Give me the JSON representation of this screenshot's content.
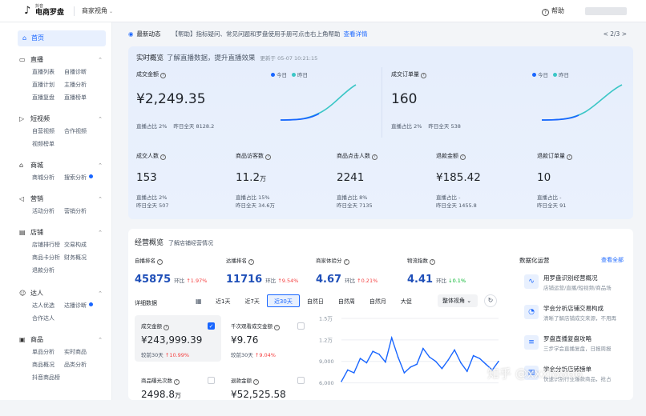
{
  "topbar": {
    "logo_small": "抖音",
    "logo_text": "电商罗盘",
    "view_switch": "商家视角",
    "help": "帮助"
  },
  "sidebar": {
    "home": "首页",
    "groups": [
      {
        "title": "直播",
        "items": [
          "直播列表",
          "自播诊断",
          "直播计划",
          "主播分析",
          "直播复盘",
          "直播榜单"
        ]
      },
      {
        "title": "短视频",
        "items": [
          "自营视频",
          "合作视频",
          "视频榜单"
        ]
      },
      {
        "title": "商城",
        "items": [
          "商城分析",
          "搜索分析"
        ]
      },
      {
        "title": "营销",
        "items": [
          "活动分析",
          "营销分析"
        ]
      },
      {
        "title": "店铺",
        "items": [
          "店铺排行榜",
          "交易构成",
          "商品卡分析",
          "财务概况",
          "退款分析"
        ]
      },
      {
        "title": "达人",
        "items": [
          "达人优选",
          "达播诊断",
          "合作达人"
        ]
      },
      {
        "title": "商品",
        "items": [
          "单品分析",
          "实时商品",
          "商品概况",
          "品类分析",
          "抖音商品榜"
        ]
      }
    ]
  },
  "notice": {
    "label": "最新动态",
    "message": "【帮助】指标疑问、常见问题和罗盘使用手册可点击右上角帮助",
    "link": "查看详情",
    "pager": "< 2/3 >"
  },
  "realtime": {
    "title": "实时概览",
    "subtitle": "了解直播数据，提升直播效果",
    "updated": "更新于 05-07 10:21:15",
    "legend_today": "今日",
    "legend_yesterday": "昨日",
    "gmv": {
      "label": "成交金额",
      "value": "¥2,249.35",
      "share": "直播占比 2%",
      "yesterday": "昨日全天 8128.2"
    },
    "orders": {
      "label": "成交订单量",
      "value": "160",
      "share": "直播占比 2%",
      "yesterday": "昨日全天 538"
    },
    "small": [
      {
        "label": "成交人数",
        "value": "153",
        "unit": "",
        "share": "直播占比 2%",
        "yesterday": "昨日全天 507"
      },
      {
        "label": "商品访客数",
        "value": "11.2",
        "unit": "万",
        "share": "直播占比 15%",
        "yesterday": "昨日全天 34.6万"
      },
      {
        "label": "商品点击人数",
        "value": "2241",
        "unit": "",
        "share": "直播占比 8%",
        "yesterday": "昨日全天 7135"
      },
      {
        "label": "退款金额",
        "value": "¥185.42",
        "unit": "",
        "share": "直播占比 -",
        "yesterday": "昨日全天 1455.8"
      },
      {
        "label": "退款订单量",
        "value": "10",
        "unit": "",
        "share": "直播占比 -",
        "yesterday": "昨日全天 91"
      }
    ]
  },
  "business": {
    "title": "经营概览",
    "subtitle": "了解店铺经营情况",
    "kpis": [
      {
        "label": "自播排名",
        "value": "45875",
        "rate_label": "环比",
        "rate": "1.97%",
        "dir": "up"
      },
      {
        "label": "达播排名",
        "value": "11716",
        "rate_label": "环比",
        "rate": "9.54%",
        "dir": "up"
      },
      {
        "label": "商家体验分",
        "value": "4.67",
        "rate_label": "环比",
        "rate": "0.21%",
        "dir": "up"
      },
      {
        "label": "物流指数",
        "value": "4.41",
        "rate_label": "环比",
        "rate": "0.1%",
        "dir": "down"
      }
    ],
    "detail_label": "详细数据",
    "ranges": [
      "近1天",
      "近7天",
      "近30天",
      "自然日",
      "自然周",
      "自然月",
      "大促"
    ],
    "active_range": 2,
    "view_select": "整体视角",
    "cards": [
      {
        "label": "成交金额",
        "value": "¥243,999.39",
        "unit": "",
        "foot_label": "较前30天",
        "rate": "10.99%",
        "checked": true
      },
      {
        "label": "千次观看成交金额",
        "value": "¥9.76",
        "unit": "",
        "foot_label": "较前30天",
        "rate": "9.04%",
        "checked": false
      },
      {
        "label": "商品曝光次数",
        "value": "2498.8",
        "unit": "万",
        "foot_label": "",
        "rate": "",
        "checked": false
      },
      {
        "label": "退款金额",
        "value": "¥52,525.58",
        "unit": "",
        "foot_label": "",
        "rate": "",
        "checked": false
      }
    ],
    "trend": {
      "type": "line",
      "y_ticks": [
        "1.5万",
        "1.2万",
        "9,000",
        "6,000"
      ],
      "values": [
        6200,
        7800,
        7400,
        9400,
        8800,
        10400,
        10000,
        8900,
        12300,
        9600,
        7400,
        8200,
        8600,
        10800,
        9600,
        9000,
        8000,
        9200,
        10600,
        8800,
        7600,
        9800,
        9400,
        8600,
        7800,
        9000
      ]
    },
    "side": {
      "title": "数据化运营",
      "all": "查看全部",
      "items": [
        {
          "icon": "chart-icon",
          "title": "用罗盘识别经营概况",
          "desc": "店铺运营/直播/短视频/商品场"
        },
        {
          "icon": "pie-icon",
          "title": "学会分析店铺交易构成",
          "desc": "清晰了解店铺成交来源，不用再"
        },
        {
          "icon": "doc-icon",
          "title": "罗盘直播复盘攻略",
          "desc": "三步学会直播复盘，日报周报"
        },
        {
          "icon": "rank-icon",
          "title": "学会分析店铺榜单",
          "desc": "快速识别行业爆款商品，抢占"
        }
      ]
    }
  },
  "watermark": "知乎 @xxxl8866",
  "colors": {
    "accent": "#1966ff",
    "today": "#1966ff",
    "yesterday": "#3bc6c6",
    "up": "#f53f3f",
    "down": "#00b42a"
  }
}
